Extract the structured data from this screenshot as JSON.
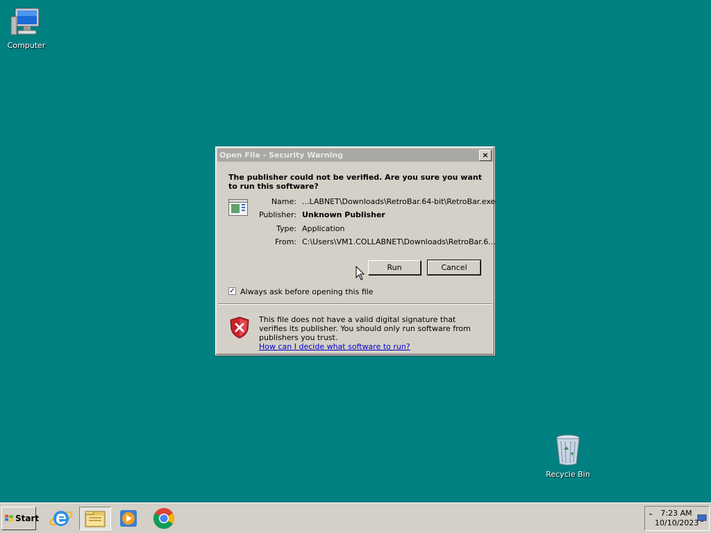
{
  "desktop": {
    "icons": [
      {
        "label": "Computer",
        "icon": "computer-icon"
      },
      {
        "label": "Recycle Bin",
        "icon": "recycle-bin-icon"
      }
    ]
  },
  "dialog": {
    "title": "Open File - Security Warning",
    "close_label": "×",
    "headline": "The publisher could not be verified.  Are you sure you want to run this software?",
    "fields": [
      {
        "label": "Name:",
        "value": "...LABNET\\Downloads\\RetroBar.64-bit\\RetroBar.exe"
      },
      {
        "label": "Publisher:",
        "value": "Unknown Publisher"
      },
      {
        "label": "Type:",
        "value": "Application"
      },
      {
        "label": "From:",
        "value": "C:\\Users\\VM1.COLLABNET\\Downloads\\RetroBar.6..."
      }
    ],
    "run_label": "Run",
    "cancel_label": "Cancel",
    "checkbox_label": "Always ask before opening this file",
    "checkbox_checked": true,
    "checkbox_mark": "✓",
    "warning_text": "This file does not have a valid digital signature that verifies its publisher.  You should only run software from publishers you trust.",
    "warning_link": "How can I decide what software to run?"
  },
  "taskbar": {
    "start_label": "Start",
    "pinned": [
      "internet-explorer-icon",
      "file-explorer-icon",
      "media-player-icon",
      "chrome-icon"
    ],
    "tray_arrow": "⌃",
    "clock_time": "7:23 AM",
    "clock_date": "10/10/2023"
  },
  "colors": {
    "desktop": "#008080",
    "dialog_face": "#d4d0c8",
    "titlebar_inactive": "#aaa8a4",
    "link": "#0000cc"
  }
}
